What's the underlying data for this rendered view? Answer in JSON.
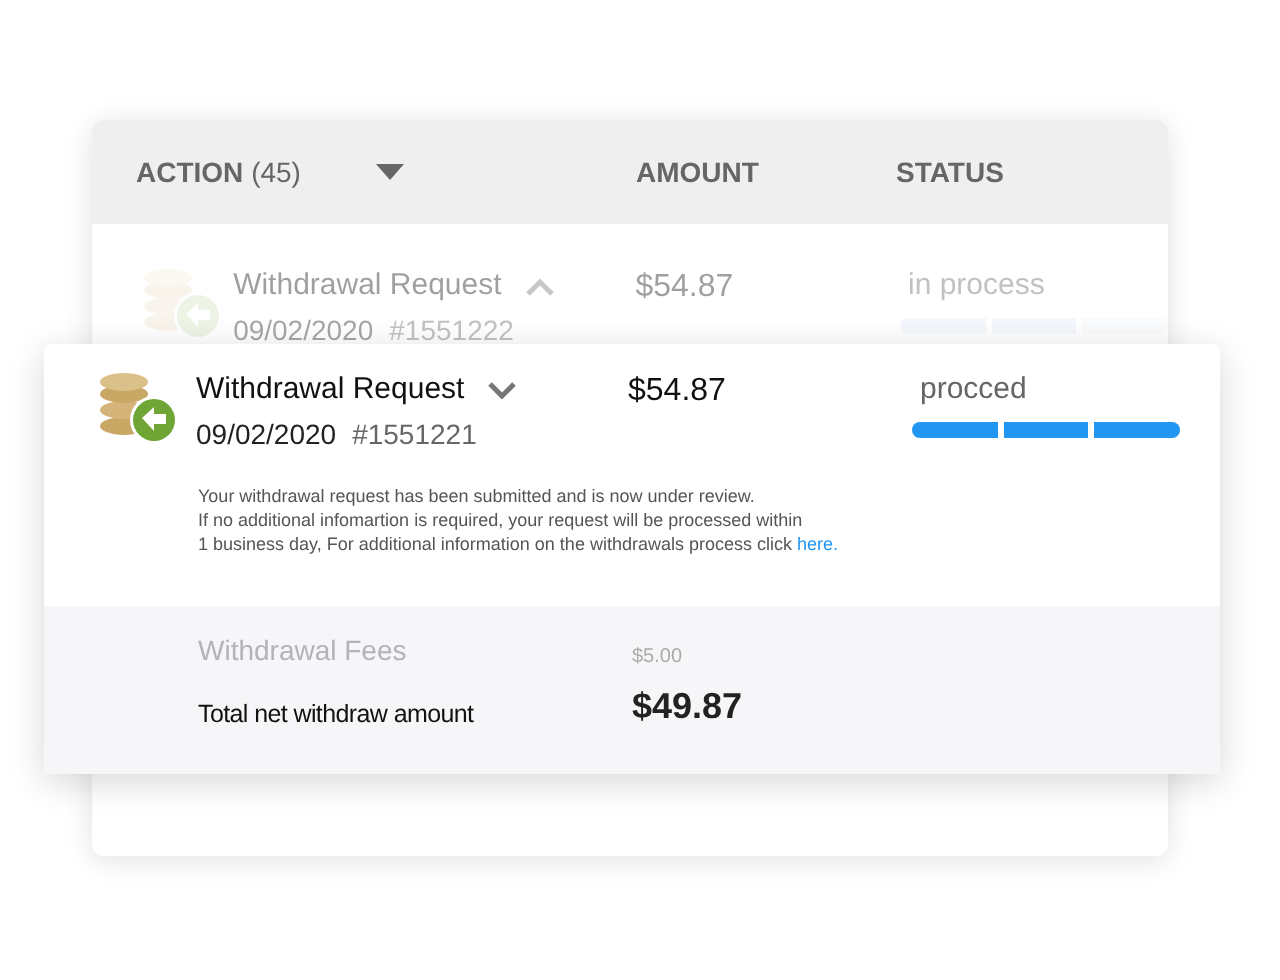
{
  "header": {
    "columns": [
      {
        "label": "ACTION",
        "count": "(45)",
        "sortable": true
      },
      {
        "label": "AMOUNT",
        "sortable": false
      },
      {
        "label": "STATUS",
        "sortable": false
      }
    ]
  },
  "rows": [
    {
      "title": "Withdrawal Request",
      "expanded": true,
      "date": "09/02/2020",
      "id": "#1551222",
      "amount": "$54.87",
      "status": "in process",
      "level": 0.67,
      "faded": true
    },
    {
      "title": "Withdrawal Request",
      "expanded": false,
      "date": "09/02/2020",
      "id": "#1551221",
      "amount": "$54.87",
      "status": "procced",
      "level": 1,
      "faded": false
    }
  ],
  "details": {
    "lines": [
      "Your withdrawal request has been submitted and is now under review.",
      "If no additional infomartion is required, your request will be processed within",
      "1 business day, For additional information on the withdrawals process click"
    ],
    "link": "here."
  },
  "summary": {
    "fees_label": "Withdrawal Fees",
    "fees": "$5.00",
    "total_label": "Total net withdraw amount",
    "total": "$49.87"
  }
}
